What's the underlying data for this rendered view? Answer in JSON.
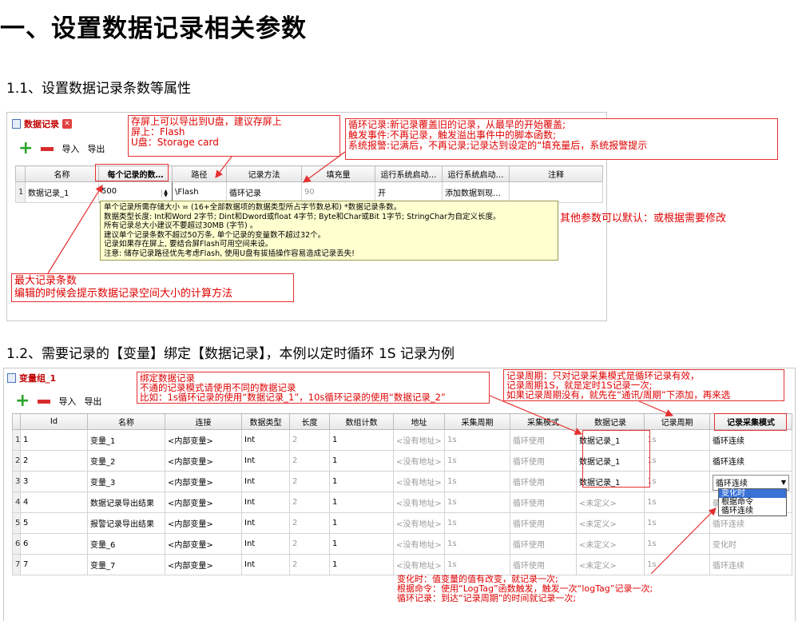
{
  "title": "一、设置数据记录相关参数",
  "section1": {
    "heading": "1.1、设置数据记录条数等属性",
    "tab_label": "数据记录",
    "toolbar": {
      "import": "导入",
      "export": "导出"
    },
    "columns": [
      "名称",
      "每个记录的数…",
      "路径",
      "记录方法",
      "填充量",
      "运行系统启动…",
      "运行系统启动…",
      "注释"
    ],
    "row": {
      "index": "1",
      "name": "数据记录_1",
      "count": "500",
      "path": "\\Flash",
      "method": "循环记录",
      "fill": "90",
      "start": "开",
      "start2": "添加数据到现…",
      "comment": ""
    },
    "tooltip": [
      "单个记录所需存储大小 = (16+全部数据项的数据类型所占字节数总和) *数据记录条数。",
      "数据类型长度: Int和Word 2字节; Dint和Dword或float 4字节; Byte和Char或Bit 1字节; StringChar为自定义长度。",
      "所有记录总大小建议不要超过30MB (字节) 。",
      "建议单个记录条数不超过50万条, 单个记录的变量数不超过32个。",
      "记录如果存在屏上, 要结合屏Flash可用空间来设。",
      "注意: 储存记录路径优先考虑Flash, 使用U盘有拔插操作容易造成记录丢失!"
    ],
    "note_path": [
      "存屏上可以导出到U盘，建议存屏上",
      "屏上：Flash",
      "U盘：Storage card"
    ],
    "note_method": [
      "循环记录:新记录覆盖旧的记录，从最早的开始覆盖;",
      "触发事件:不再记录，触发溢出事件中的脚本函数;",
      "系统报警:记满后，不再记录;记录达到设定的“填充量后，系统报警提示"
    ],
    "note_other": "其他参数可以默认：或根据需要修改",
    "note_count": [
      "最大记录条数",
      "编辑的时候会提示数据记录空间大小的计算方法"
    ]
  },
  "section2": {
    "heading": "1.2、需要记录的【变量】绑定【数据记录】，本例以定时循环 1S 记录为例",
    "tab_label": "变量组_1",
    "toolbar": {
      "import": "导入",
      "export": "导出"
    },
    "columns": [
      "Id",
      "名称",
      "连接",
      "数据类型",
      "长度",
      "数组计数",
      "地址",
      "采集周期",
      "采集模式",
      "数据记录",
      "记录周期",
      "记录采集模式"
    ],
    "rows": [
      {
        "n": "1",
        "id": "1",
        "name": "变量_1",
        "conn": "<内部变量>",
        "type": "Int",
        "len": "2",
        "arr": "1",
        "addr": "<没有地址>",
        "cycle": "1s",
        "mode": "循环使用",
        "log": "数据记录_1",
        "logcycle": "1s",
        "logmode": "循环连续"
      },
      {
        "n": "2",
        "id": "2",
        "name": "变量_2",
        "conn": "<内部变量>",
        "type": "Int",
        "len": "2",
        "arr": "1",
        "addr": "<没有地址>",
        "cycle": "1s",
        "mode": "循环使用",
        "log": "数据记录_1",
        "logcycle": "1s",
        "logmode": "循环连续"
      },
      {
        "n": "3",
        "id": "3",
        "name": "变量_3",
        "conn": "<内部变量>",
        "type": "Int",
        "len": "2",
        "arr": "1",
        "addr": "<没有地址>",
        "cycle": "1s",
        "mode": "循环使用",
        "log": "数据记录_1",
        "logcycle": "1s",
        "logmode": "循环连续"
      },
      {
        "n": "4",
        "id": "4",
        "name": "数据记录导出结果",
        "conn": "<内部变量>",
        "type": "Int",
        "len": "2",
        "arr": "1",
        "addr": "<没有地址>",
        "cycle": "1s",
        "mode": "循环使用",
        "log": "<未定义>",
        "logcycle": "1s",
        "logmode": "循环连续"
      },
      {
        "n": "5",
        "id": "5",
        "name": "报警记录导出结果",
        "conn": "<内部变量>",
        "type": "Int",
        "len": "2",
        "arr": "1",
        "addr": "<没有地址>",
        "cycle": "1s",
        "mode": "循环使用",
        "log": "<未定义>",
        "logcycle": "1s",
        "logmode": "循环连续"
      },
      {
        "n": "6",
        "id": "6",
        "name": "变量_6",
        "conn": "<内部变量>",
        "type": "Int",
        "len": "2",
        "arr": "1",
        "addr": "<没有地址>",
        "cycle": "1s",
        "mode": "循环使用",
        "log": "<未定义>",
        "logcycle": "1s",
        "logmode": "变化时"
      },
      {
        "n": "7",
        "id": "7",
        "name": "变量_7",
        "conn": "<内部变量>",
        "type": "Int",
        "len": "2",
        "arr": "1",
        "addr": "<没有地址>",
        "cycle": "1s",
        "mode": "循环使用",
        "log": "<未定义>",
        "logcycle": "1s",
        "logmode": "循环连续"
      }
    ],
    "dropdown_options": [
      "变化时",
      "根据命令",
      "循环连续"
    ],
    "note_bind": [
      "绑定数据记录",
      "不通的记录模式请使用不同的数据记录",
      "比如：1s循环记录的使用“数据记录_1”，10s循环记录的使用“数据记录_2”"
    ],
    "note_cycle": [
      "记录周期：只对记录采集模式是循环记录有效，",
      "记录周期1S，就是定时1S记录一次;",
      "如果记录周期没有，就先在“通讯/周期”下添加，再来选"
    ],
    "note_mode": [
      "变化时：值变量的值有改变，就记录一次;",
      "根据命令：使用“LogTag”函数触发，触发一次“logTag”记录一次;",
      "循环记录：到达“记录周期”的时间就记录一次;"
    ]
  }
}
